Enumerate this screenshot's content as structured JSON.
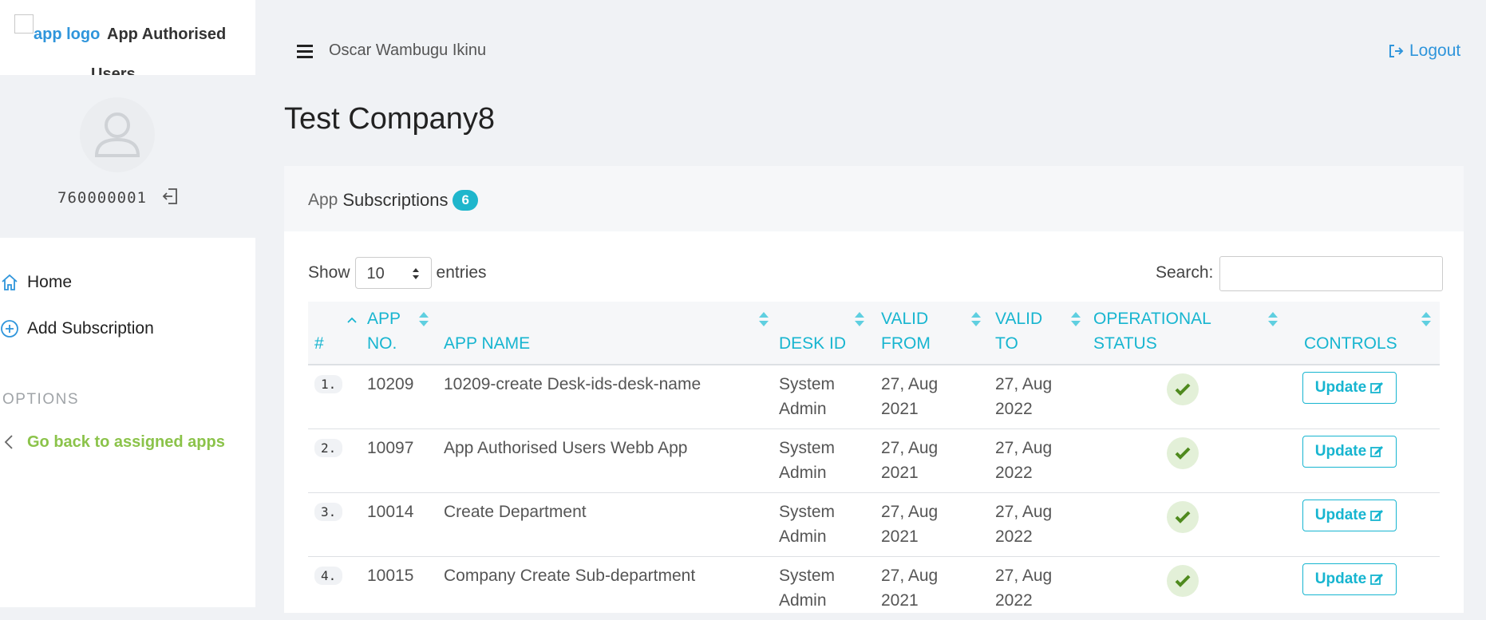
{
  "brand": {
    "logo_alt": "app logo",
    "title_line1": "App Authorised",
    "title_line2": "Users"
  },
  "profile": {
    "user_id": "760000001"
  },
  "sidebar": {
    "items": [
      {
        "label": "Home",
        "icon": "home-icon"
      },
      {
        "label": "Add Subscription",
        "icon": "plus-circle-icon"
      }
    ],
    "options_heading": "OPTIONS",
    "back_link": {
      "label": "Go back to assigned apps",
      "icon": "chevron-left-icon"
    }
  },
  "topbar": {
    "user_name": "Oscar Wambugu Ikinu",
    "logout_label": "Logout"
  },
  "page": {
    "title": "Test Company8"
  },
  "card": {
    "title_muted": "App",
    "title_strong": "Subscriptions",
    "badge_count": "6"
  },
  "table_controls": {
    "show_label": "Show",
    "page_size": "10",
    "entries_label": "entries",
    "search_label": "Search:",
    "search_value": ""
  },
  "table": {
    "columns": [
      {
        "line1": "#",
        "line2": ""
      },
      {
        "line1": "APP",
        "line2": "NO."
      },
      {
        "line1": "APP NAME",
        "line2": ""
      },
      {
        "line1": "DESK ID",
        "line2": ""
      },
      {
        "line1": "VALID",
        "line2": "FROM"
      },
      {
        "line1": "VALID",
        "line2": "TO"
      },
      {
        "line1": "OPERATIONAL",
        "line2": "STATUS"
      },
      {
        "line1": "CONTROLS",
        "line2": ""
      }
    ],
    "rows": [
      {
        "num": "1.",
        "app_no": "10209",
        "app_name": "10209-create Desk-ids-desk-name",
        "desk1": "System",
        "desk2": "Admin",
        "from1": "27, Aug",
        "from2": "2021",
        "to1": "27, Aug",
        "to2": "2022",
        "status": "active",
        "action": "Update"
      },
      {
        "num": "2.",
        "app_no": "10097",
        "app_name": "App Authorised Users Webb App",
        "desk1": "System",
        "desk2": "Admin",
        "from1": "27, Aug",
        "from2": "2021",
        "to1": "27, Aug",
        "to2": "2022",
        "status": "active",
        "action": "Update"
      },
      {
        "num": "3.",
        "app_no": "10014",
        "app_name": "Create Department",
        "desk1": "System",
        "desk2": "Admin",
        "from1": "27, Aug",
        "from2": "2021",
        "to1": "27, Aug",
        "to2": "2022",
        "status": "active",
        "action": "Update"
      },
      {
        "num": "4.",
        "app_no": "10015",
        "app_name": "Company Create Sub-department",
        "desk1": "System",
        "desk2": "Admin",
        "from1": "27, Aug",
        "from2": "2021",
        "to1": "27, Aug",
        "to2": "2022",
        "status": "active",
        "action": "Update"
      }
    ]
  },
  "colors": {
    "accent": "#17b5d0",
    "link": "#2f95db",
    "back_link": "#8bc34a",
    "status_bg": "#e3f0d8",
    "status_check": "#4f8a1e"
  }
}
